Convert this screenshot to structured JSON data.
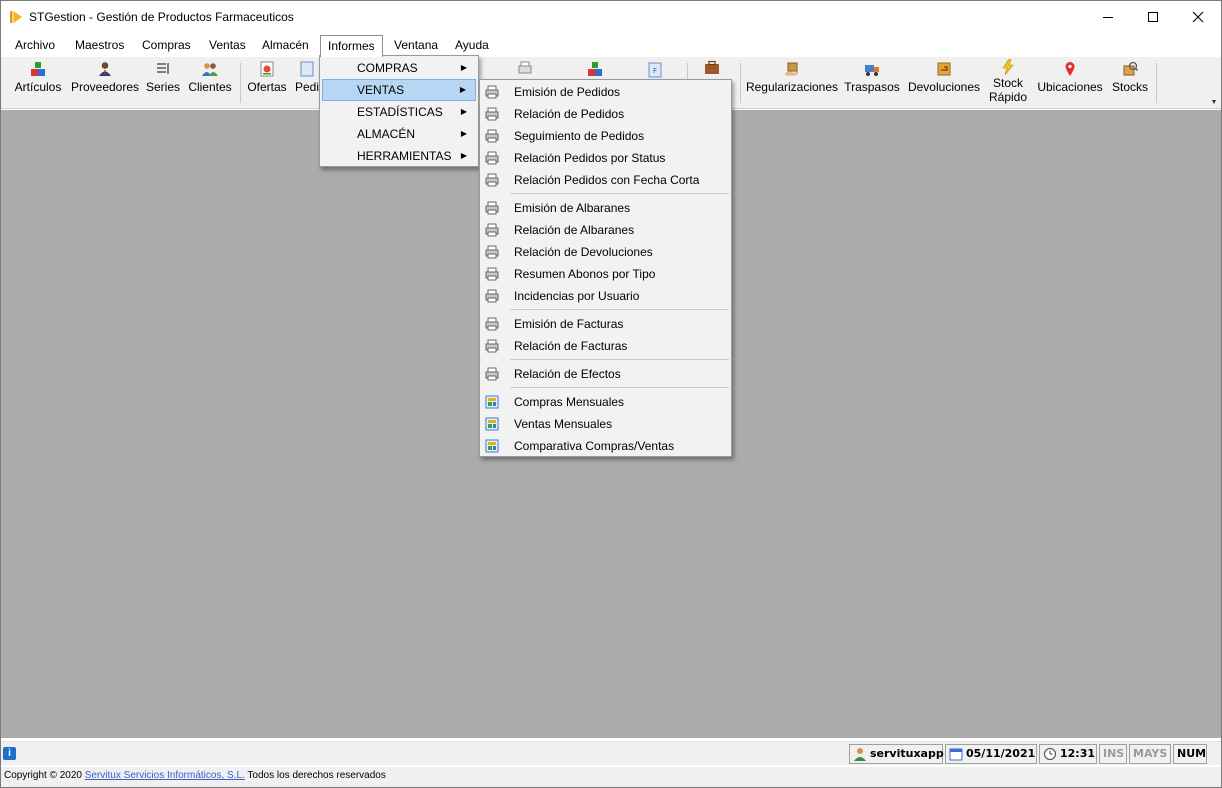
{
  "window": {
    "title": "STGestion - Gestión de Productos Farmaceuticos"
  },
  "menubar": {
    "items": [
      "Archivo",
      "Maestros",
      "Compras",
      "Ventas",
      "Almacén",
      "Informes",
      "Ventana",
      "Ayuda"
    ],
    "active": "Informes"
  },
  "toolbar": {
    "buttons": [
      "Artículos",
      "Proveedores",
      "Series",
      "Clientes",
      "Ofertas",
      "Pedi",
      "Regularizaciones",
      "Traspasos",
      "Devoluciones",
      "Stock Rápido",
      "Ubicaciones",
      "Stocks"
    ],
    "stock_rapido_line1": "Stock",
    "stock_rapido_line2": "Rápido"
  },
  "informes_menu": {
    "items": [
      "COMPRAS",
      "VENTAS",
      "ESTADÍSTICAS",
      "ALMACÉN",
      "HERRAMIENTAS"
    ],
    "highlighted": "VENTAS"
  },
  "ventas_submenu": {
    "groups": [
      [
        "Emisión de Pedidos",
        "Relación de Pedidos",
        "Seguimiento de Pedidos",
        "Relación Pedidos por Status",
        "Relación Pedidos con Fecha Corta"
      ],
      [
        "Emisión de Albaranes",
        "Relación de Albaranes",
        "Relación de Devoluciones",
        "Resumen Abonos por Tipo",
        "Incidencias por Usuario"
      ],
      [
        "Emisión de Facturas",
        "Relación de Facturas"
      ],
      [
        "Relación de Efectos"
      ],
      [
        "Compras Mensuales",
        "Ventas Mensuales",
        "Comparativa Compras/Ventas"
      ]
    ]
  },
  "statusbar": {
    "user": "servituxapp",
    "date": "05/11/2021",
    "time": "12:31",
    "ins": "INS",
    "mays": "MAYS",
    "num": "NUM"
  },
  "footer": {
    "copyright_prefix": "Copyright © 2020",
    "company_link": "Servitux Servicios Informáticos, S.L.",
    "rights": "Todos los derechos reservados"
  },
  "colors": {
    "workspace": "#ababab",
    "highlight": "#b7d6f3",
    "link": "#3a5fc8"
  }
}
